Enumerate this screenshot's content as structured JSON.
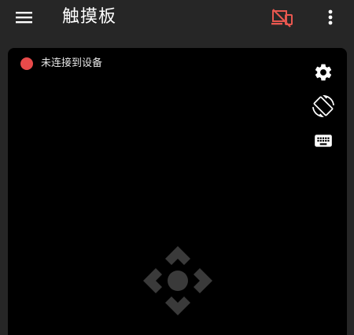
{
  "header": {
    "title": "触摸板",
    "icons": {
      "menu": "menu-icon",
      "device": "device-disconnected-icon",
      "more": "more-vert-icon"
    }
  },
  "touchpad": {
    "status_text": "未连接到设备",
    "icons": {
      "settings": "gear-icon",
      "rotate": "screen-rotation-icon",
      "keyboard": "keyboard-icon",
      "dpad": "dpad-icon"
    }
  },
  "colors": {
    "background": "#262626",
    "touchpad": "#000000",
    "status_disconnected": "#e84a4a",
    "device_icon": "#e8574f",
    "icon": "#ffffff",
    "dpad": "#3a3a3a"
  }
}
